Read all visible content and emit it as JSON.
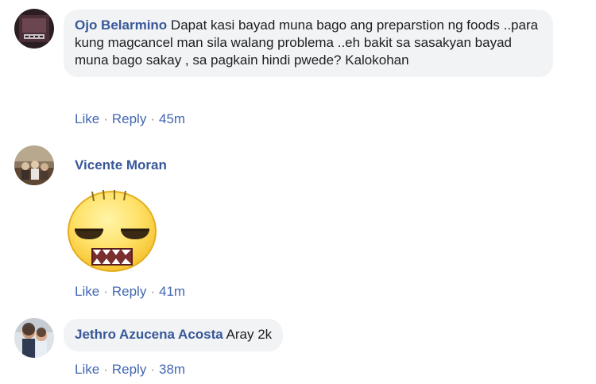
{
  "comments": [
    {
      "author": "Ojo Belarmino",
      "text": "Dapat kasi bayad muna bago ang preparstion ng foods ..para kung magcancel man sila walang problema ..eh bakit sa sasakyan bayad muna bago sakay , sa pagkain hindi pwede? Kalokohan",
      "like_label": "Like",
      "reply_label": "Reply",
      "time": "45m"
    },
    {
      "author": "Vicente Moran",
      "sticker_icon": "unamused-face-sticker",
      "like_label": "Like",
      "reply_label": "Reply",
      "time": "41m"
    },
    {
      "author": "Jethro Azucena Acosta",
      "text": "Aray 2k",
      "like_label": "Like",
      "reply_label": "Reply",
      "time": "38m"
    }
  ],
  "colors": {
    "author_link": "#385898",
    "action_link": "#4267b2",
    "bubble_bg": "#f2f3f5",
    "meta_text": "#606770"
  }
}
